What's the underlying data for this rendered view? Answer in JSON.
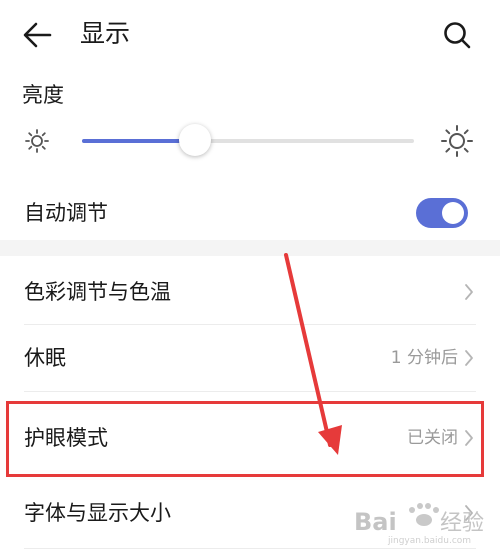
{
  "header": {
    "title": "显示",
    "back_icon": "back-arrow-icon",
    "search_icon": "search-icon"
  },
  "brightness": {
    "label": "亮度",
    "level_fraction": 0.34,
    "min_icon": "sun-small-icon",
    "max_icon": "sun-large-icon"
  },
  "auto_adjust": {
    "label": "自动调节",
    "enabled": true
  },
  "items": [
    {
      "label": "色彩调节与色温",
      "value": ""
    },
    {
      "label": "休眠",
      "value": "1 分钟后"
    },
    {
      "label": "护眼模式",
      "value": "已关闭"
    },
    {
      "label": "字体与显示大小",
      "value": ""
    }
  ],
  "watermark": {
    "text": "Bai du 经验",
    "subtext": "jingyan.baidu.com"
  },
  "colors": {
    "accent": "#5a6fd6",
    "highlight": "#e63a3a",
    "secondary_text": "#9a9a9a"
  }
}
